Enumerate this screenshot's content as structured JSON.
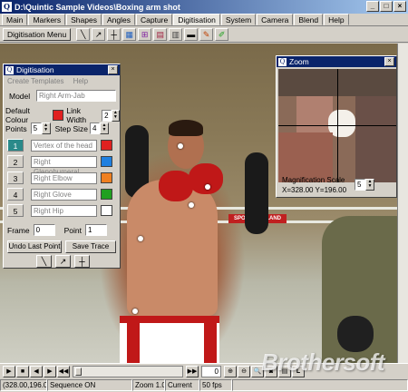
{
  "window": {
    "title": "D:\\Quintic Sample Videos\\Boxing arm shot",
    "app_icon": "Q"
  },
  "menu": {
    "tabs": [
      "Main",
      "Markers",
      "Shapes",
      "Angles",
      "Capture",
      "Digitisation",
      "System",
      "Camera",
      "Blend",
      "Help"
    ],
    "active": "Digitisation"
  },
  "toolbar": {
    "digitisation_menu_label": "Digitisation Menu"
  },
  "digitisation": {
    "title": "Digitisation",
    "menu": [
      "Create Templates",
      "Help"
    ],
    "model_label": "Model",
    "model_value": "Right Arm-Jab",
    "default_colour_label": "Default Colour",
    "link_width_label": "Link Width",
    "link_width_value": "2",
    "points_label": "Points",
    "points_value": "5",
    "step_size_label": "Step Size",
    "step_size_value": "4",
    "points": [
      {
        "num": "1",
        "name": "Vertex of the head",
        "color": "#e02020"
      },
      {
        "num": "2",
        "name": "Right Glenohumeral",
        "color": "#2080e0"
      },
      {
        "num": "3",
        "name": "Right Elbow",
        "color": "#f08020"
      },
      {
        "num": "4",
        "name": "Right Glove",
        "color": "#20a020"
      },
      {
        "num": "5",
        "name": "Right Hip",
        "color": "#ffffff"
      }
    ],
    "frame_label": "Frame",
    "frame_value": "0",
    "point_label": "Point",
    "point_value": "1",
    "undo_label": "Undo Last Point",
    "save_label": "Save Trace",
    "default_colour": "#e02020"
  },
  "zoom": {
    "title": "Zoom",
    "magnification_label": "Magnification Scale",
    "coords": "X=328.00    Y=196.00",
    "scale_value": "5"
  },
  "transport": {
    "frame_value": "0"
  },
  "status": {
    "coords": "(328.00,196.00)",
    "sequence": "Sequence ON",
    "zoom": "Zoom  1.0",
    "current": "Current",
    "fps": "50 fps"
  },
  "watermark": "Brothersoft"
}
